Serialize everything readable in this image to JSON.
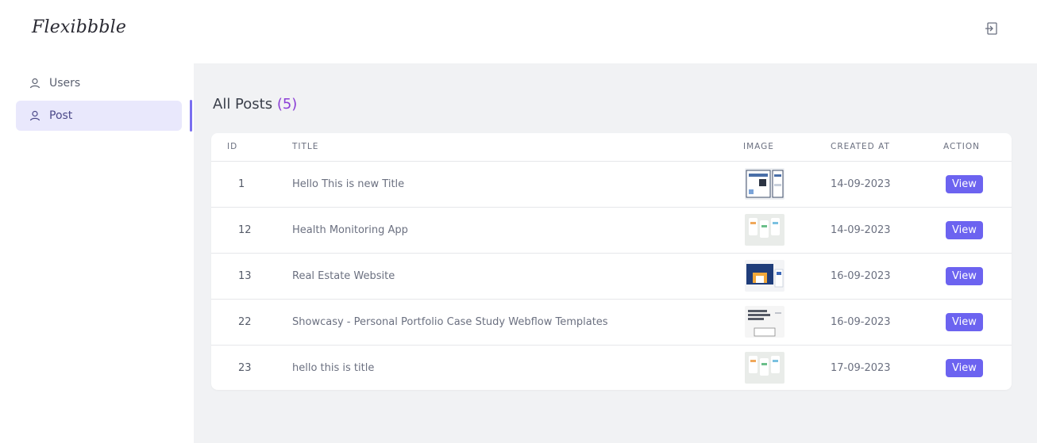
{
  "app": {
    "logo": "Flexibbble"
  },
  "header": {
    "logout_icon": "logout-icon"
  },
  "sidebar": {
    "items": [
      {
        "label": "Users",
        "icon": "user-icon",
        "active": false
      },
      {
        "label": "Post",
        "icon": "user-icon",
        "active": true
      }
    ]
  },
  "main": {
    "title": "All Posts",
    "count_open": "(",
    "count": "5",
    "count_close": ")"
  },
  "table": {
    "headers": {
      "id": "ID",
      "title": "TITLE",
      "image": "IMAGE",
      "created": "CREATED AT",
      "action": "ACTION"
    },
    "rows": [
      {
        "id": "1",
        "title": "Hello This is new Title",
        "created": "14-09-2023",
        "action": "View",
        "image": "thumbnail-dashboard"
      },
      {
        "id": "12",
        "title": "Health Monitoring App",
        "created": "14-09-2023",
        "action": "View",
        "image": "thumbnail-app"
      },
      {
        "id": "13",
        "title": "Real Estate Website",
        "created": "16-09-2023",
        "action": "View",
        "image": "thumbnail-website"
      },
      {
        "id": "22",
        "title": "Showcasy - Personal Portfolio Case Study Webflow Templates",
        "created": "16-09-2023",
        "action": "View",
        "image": "thumbnail-portfolio"
      },
      {
        "id": "23",
        "title": "hello this is title",
        "created": "17-09-2023",
        "action": "View",
        "image": "thumbnail-app"
      }
    ]
  },
  "colors": {
    "accent": "#6c63f0",
    "active_bg": "#e9e8fc",
    "count": "#8b3fd6",
    "main_bg": "#f1f2f4"
  }
}
